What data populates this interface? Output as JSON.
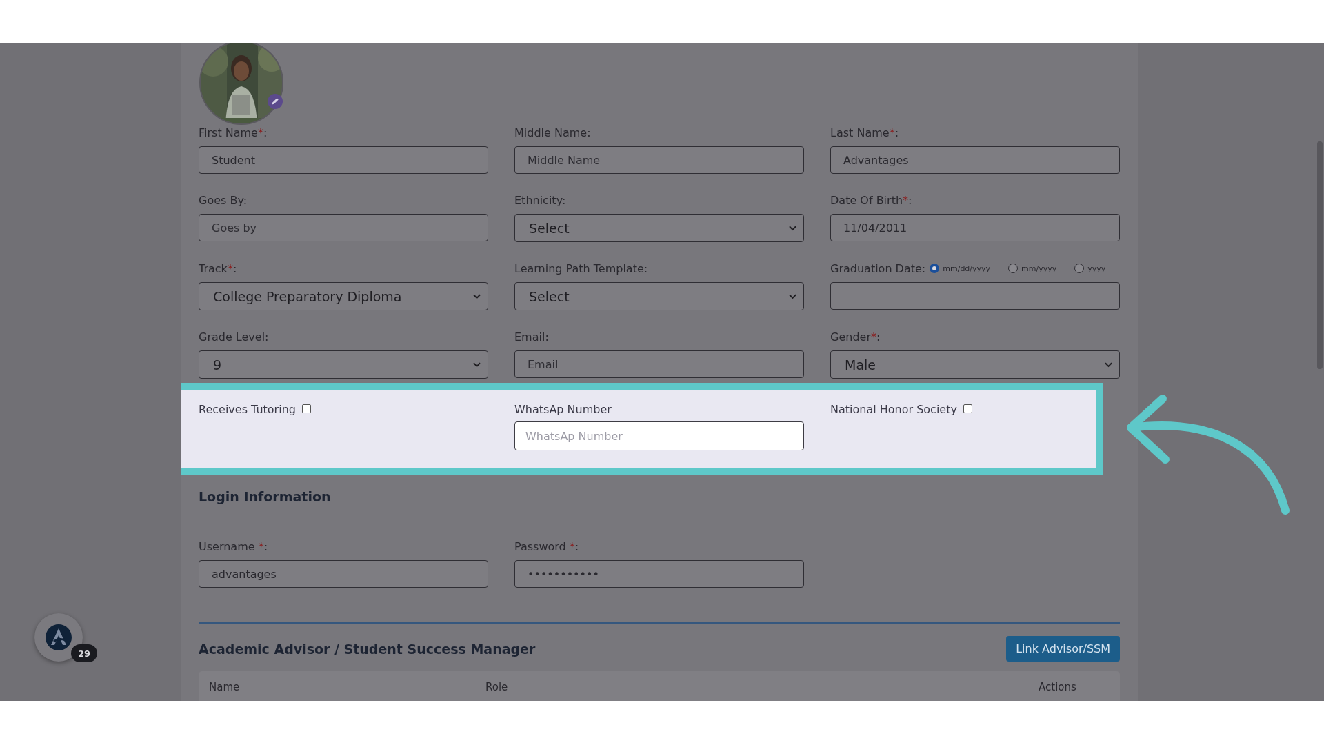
{
  "profile_form": {
    "rows": [
      [
        {
          "kind": "text",
          "label": "First Name",
          "required": "*",
          "after": ":",
          "value": "Student"
        },
        {
          "kind": "text",
          "label": "Middle Name:",
          "placeholder": "Middle Name"
        },
        {
          "kind": "text",
          "label": "Last Name",
          "required": "*",
          "after": ":",
          "value": "Advantages"
        }
      ],
      [
        {
          "kind": "text",
          "label": "Goes By:",
          "placeholder": "Goes by"
        },
        {
          "kind": "select",
          "label": "Ethnicity:",
          "value": "Select"
        },
        {
          "kind": "text",
          "label": "Date Of Birth",
          "required": "*",
          "after": ":",
          "value": "11/04/2011"
        }
      ],
      [
        {
          "kind": "select",
          "label": "Track",
          "required": "*",
          "after": ":",
          "value": "College Preparatory Diploma"
        },
        {
          "kind": "select",
          "label": "Learning Path Template:",
          "value": "Select"
        },
        {
          "kind": "radio_date",
          "label": "Graduation Date:",
          "options": [
            {
              "label": "mm/dd/yyyy",
              "selected": true
            },
            {
              "label": "mm/yyyy",
              "selected": false
            },
            {
              "label": "yyyy",
              "selected": false
            }
          ]
        }
      ],
      [
        {
          "kind": "select",
          "label": "Grade Level:",
          "value": "9"
        },
        {
          "kind": "text",
          "label": "Email:",
          "placeholder": "Email"
        },
        {
          "kind": "select",
          "label": "Gender",
          "required": "*",
          "after": ":",
          "value": "Male"
        }
      ]
    ]
  },
  "highlighted_row": [
    {
      "kind": "checkbox",
      "label": "Receives Tutoring",
      "checked": false
    },
    {
      "kind": "text",
      "label": "WhatsAp Number",
      "placeholder": "WhatsAp Number"
    },
    {
      "kind": "checkbox",
      "label": "National Honor Society",
      "checked": false
    }
  ],
  "login": {
    "title": "Login Information",
    "fields": [
      {
        "label": "Username ",
        "required": "*",
        "after": ":",
        "value": "advantages"
      },
      {
        "label": "Password ",
        "required": "*",
        "after": ":",
        "value": "•••••••••••"
      }
    ]
  },
  "advisor": {
    "title": "Academic Advisor / Student Success Manager",
    "button": "Link Advisor/SSM",
    "columns": [
      "Name",
      "Role",
      "Actions"
    ]
  },
  "chat_widget": {
    "badge": "29"
  }
}
